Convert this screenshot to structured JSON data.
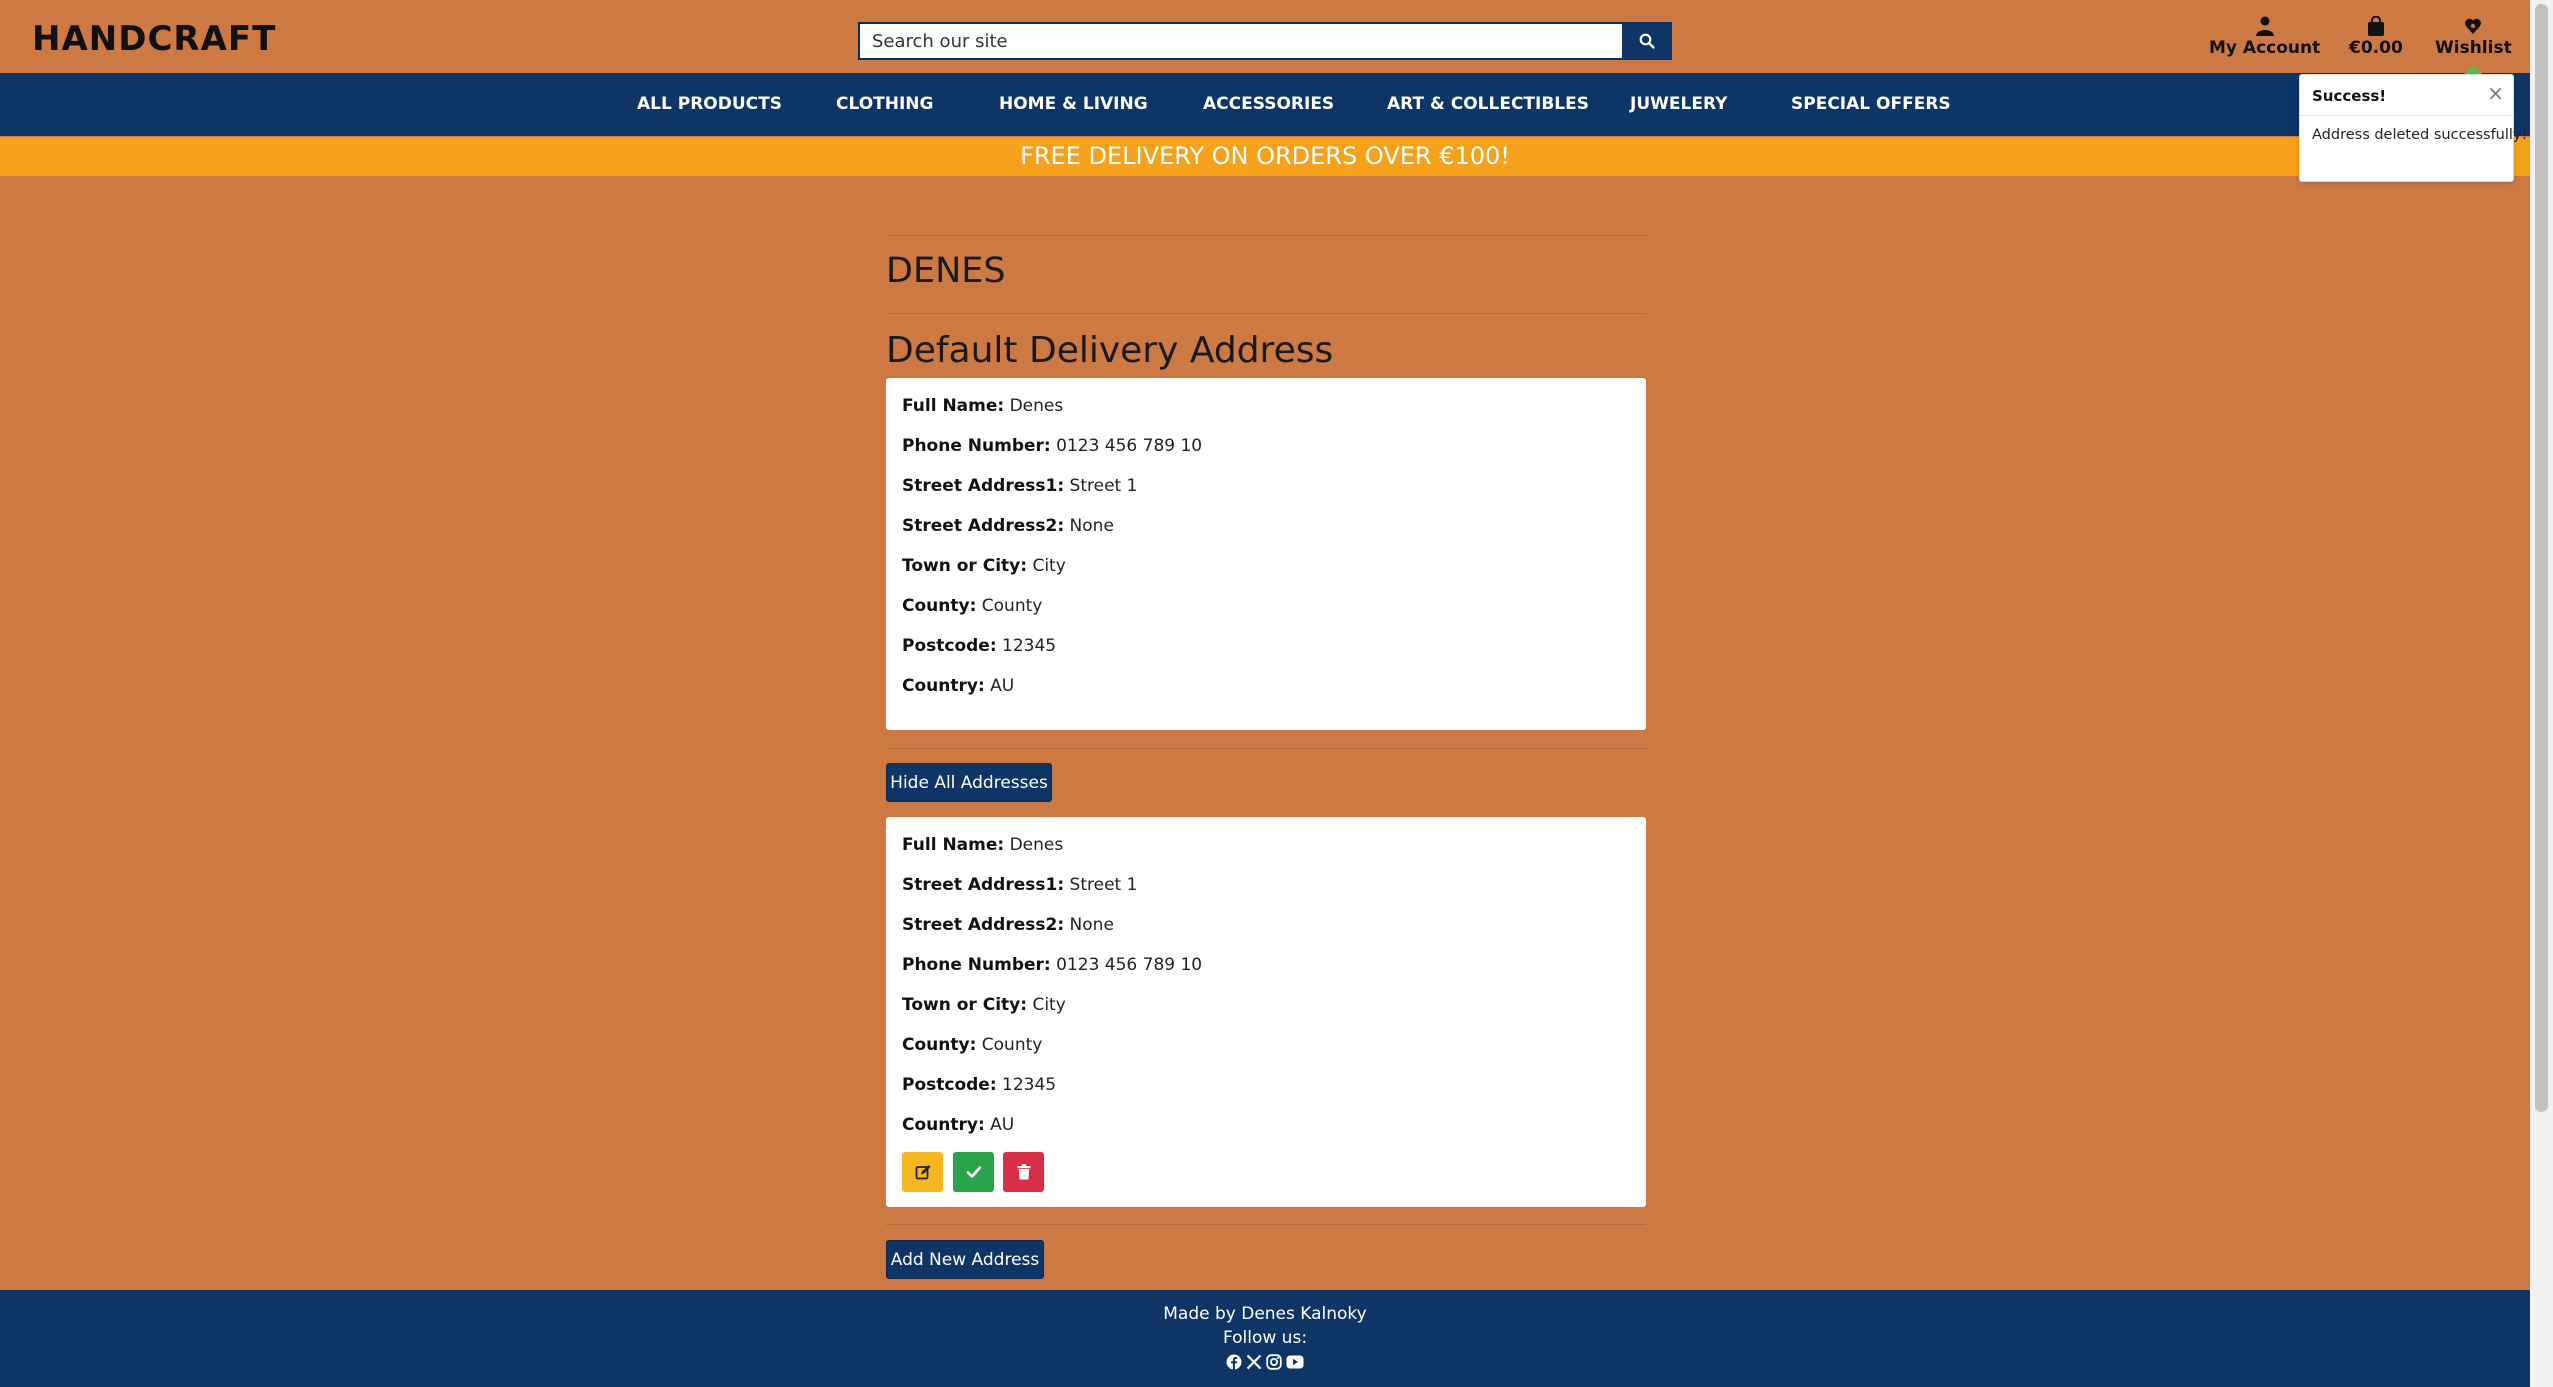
{
  "header": {
    "logo": "HANDCRAFT",
    "search_placeholder": "Search our site",
    "account_label": "My Account",
    "cart_total": "€0.00",
    "wishlist_label": "Wishlist"
  },
  "nav": {
    "items": [
      "ALL PRODUCTS",
      "CLOTHING",
      "HOME & LIVING",
      "ACCESSORIES",
      "ART & COLLECTIBLES",
      "JUWELERY",
      "SPECIAL OFFERS"
    ]
  },
  "banner": "FREE DELIVERY ON ORDERS OVER €100!",
  "toast": {
    "title": "Success!",
    "close": "×",
    "message": "Address deleted successfully!"
  },
  "profile": {
    "username": "DENES",
    "default_title": "Default Delivery Address"
  },
  "default_address": [
    {
      "label": "Full Name:",
      "value": "Denes"
    },
    {
      "label": "Phone Number:",
      "value": "0123 456 789 10"
    },
    {
      "label": "Street Address1:",
      "value": "Street 1"
    },
    {
      "label": "Street Address2:",
      "value": "None"
    },
    {
      "label": "Town or City:",
      "value": "City"
    },
    {
      "label": "County:",
      "value": "County"
    },
    {
      "label": "Postcode:",
      "value": "12345"
    },
    {
      "label": "Country:",
      "value": "AU"
    }
  ],
  "hide_button": "Hide All Addresses",
  "address_list": [
    {
      "label": "Full Name:",
      "value": "Denes"
    },
    {
      "label": "Street Address1:",
      "value": "Street 1"
    },
    {
      "label": "Street Address2:",
      "value": "None"
    },
    {
      "label": "Phone Number:",
      "value": "0123 456 789 10"
    },
    {
      "label": "Town or City:",
      "value": "City"
    },
    {
      "label": "County:",
      "value": "County"
    },
    {
      "label": "Postcode:",
      "value": "12345"
    },
    {
      "label": "Country:",
      "value": "AU"
    }
  ],
  "action_buttons": {
    "edit_color": "#f5b820",
    "default_color": "#2aa44a",
    "delete_color": "#d9304a"
  },
  "add_button": "Add New Address",
  "footer": {
    "made_by": "Made by Denes Kalnoky",
    "follow": "Follow us:",
    "social_icons": [
      "facebook-icon",
      "x-icon",
      "instagram-icon",
      "youtube-icon"
    ]
  },
  "colors": {
    "background": "#cc7943",
    "navy": "#0e3566",
    "banner": "#f5a11c"
  }
}
